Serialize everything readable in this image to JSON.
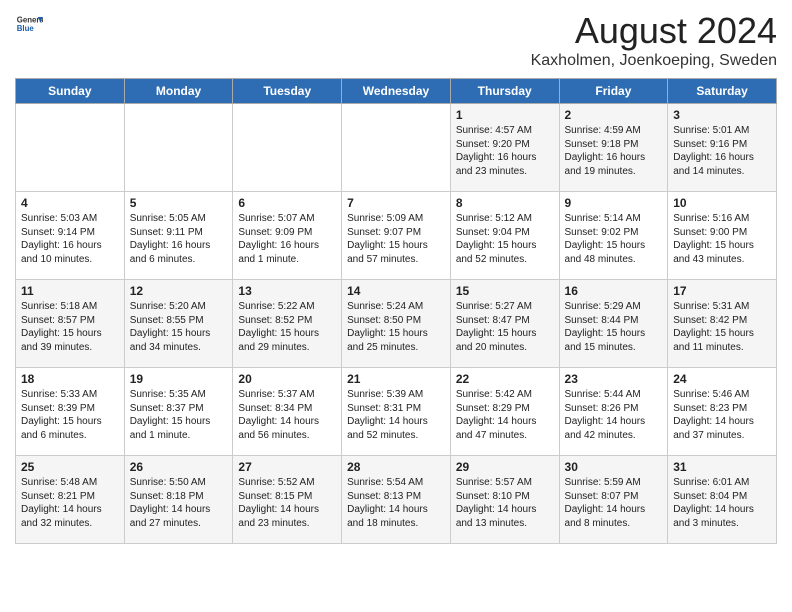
{
  "header": {
    "logo_general": "General",
    "logo_blue": "Blue",
    "title": "August 2024",
    "subtitle": "Kaxholmen, Joenkoeping, Sweden"
  },
  "days_of_week": [
    "Sunday",
    "Monday",
    "Tuesday",
    "Wednesday",
    "Thursday",
    "Friday",
    "Saturday"
  ],
  "weeks": [
    [
      {
        "day": "",
        "content": ""
      },
      {
        "day": "",
        "content": ""
      },
      {
        "day": "",
        "content": ""
      },
      {
        "day": "",
        "content": ""
      },
      {
        "day": "1",
        "content": "Sunrise: 4:57 AM\nSunset: 9:20 PM\nDaylight: 16 hours\nand 23 minutes."
      },
      {
        "day": "2",
        "content": "Sunrise: 4:59 AM\nSunset: 9:18 PM\nDaylight: 16 hours\nand 19 minutes."
      },
      {
        "day": "3",
        "content": "Sunrise: 5:01 AM\nSunset: 9:16 PM\nDaylight: 16 hours\nand 14 minutes."
      }
    ],
    [
      {
        "day": "4",
        "content": "Sunrise: 5:03 AM\nSunset: 9:14 PM\nDaylight: 16 hours\nand 10 minutes."
      },
      {
        "day": "5",
        "content": "Sunrise: 5:05 AM\nSunset: 9:11 PM\nDaylight: 16 hours\nand 6 minutes."
      },
      {
        "day": "6",
        "content": "Sunrise: 5:07 AM\nSunset: 9:09 PM\nDaylight: 16 hours\nand 1 minute."
      },
      {
        "day": "7",
        "content": "Sunrise: 5:09 AM\nSunset: 9:07 PM\nDaylight: 15 hours\nand 57 minutes."
      },
      {
        "day": "8",
        "content": "Sunrise: 5:12 AM\nSunset: 9:04 PM\nDaylight: 15 hours\nand 52 minutes."
      },
      {
        "day": "9",
        "content": "Sunrise: 5:14 AM\nSunset: 9:02 PM\nDaylight: 15 hours\nand 48 minutes."
      },
      {
        "day": "10",
        "content": "Sunrise: 5:16 AM\nSunset: 9:00 PM\nDaylight: 15 hours\nand 43 minutes."
      }
    ],
    [
      {
        "day": "11",
        "content": "Sunrise: 5:18 AM\nSunset: 8:57 PM\nDaylight: 15 hours\nand 39 minutes."
      },
      {
        "day": "12",
        "content": "Sunrise: 5:20 AM\nSunset: 8:55 PM\nDaylight: 15 hours\nand 34 minutes."
      },
      {
        "day": "13",
        "content": "Sunrise: 5:22 AM\nSunset: 8:52 PM\nDaylight: 15 hours\nand 29 minutes."
      },
      {
        "day": "14",
        "content": "Sunrise: 5:24 AM\nSunset: 8:50 PM\nDaylight: 15 hours\nand 25 minutes."
      },
      {
        "day": "15",
        "content": "Sunrise: 5:27 AM\nSunset: 8:47 PM\nDaylight: 15 hours\nand 20 minutes."
      },
      {
        "day": "16",
        "content": "Sunrise: 5:29 AM\nSunset: 8:44 PM\nDaylight: 15 hours\nand 15 minutes."
      },
      {
        "day": "17",
        "content": "Sunrise: 5:31 AM\nSunset: 8:42 PM\nDaylight: 15 hours\nand 11 minutes."
      }
    ],
    [
      {
        "day": "18",
        "content": "Sunrise: 5:33 AM\nSunset: 8:39 PM\nDaylight: 15 hours\nand 6 minutes."
      },
      {
        "day": "19",
        "content": "Sunrise: 5:35 AM\nSunset: 8:37 PM\nDaylight: 15 hours\nand 1 minute."
      },
      {
        "day": "20",
        "content": "Sunrise: 5:37 AM\nSunset: 8:34 PM\nDaylight: 14 hours\nand 56 minutes."
      },
      {
        "day": "21",
        "content": "Sunrise: 5:39 AM\nSunset: 8:31 PM\nDaylight: 14 hours\nand 52 minutes."
      },
      {
        "day": "22",
        "content": "Sunrise: 5:42 AM\nSunset: 8:29 PM\nDaylight: 14 hours\nand 47 minutes."
      },
      {
        "day": "23",
        "content": "Sunrise: 5:44 AM\nSunset: 8:26 PM\nDaylight: 14 hours\nand 42 minutes."
      },
      {
        "day": "24",
        "content": "Sunrise: 5:46 AM\nSunset: 8:23 PM\nDaylight: 14 hours\nand 37 minutes."
      }
    ],
    [
      {
        "day": "25",
        "content": "Sunrise: 5:48 AM\nSunset: 8:21 PM\nDaylight: 14 hours\nand 32 minutes."
      },
      {
        "day": "26",
        "content": "Sunrise: 5:50 AM\nSunset: 8:18 PM\nDaylight: 14 hours\nand 27 minutes."
      },
      {
        "day": "27",
        "content": "Sunrise: 5:52 AM\nSunset: 8:15 PM\nDaylight: 14 hours\nand 23 minutes."
      },
      {
        "day": "28",
        "content": "Sunrise: 5:54 AM\nSunset: 8:13 PM\nDaylight: 14 hours\nand 18 minutes."
      },
      {
        "day": "29",
        "content": "Sunrise: 5:57 AM\nSunset: 8:10 PM\nDaylight: 14 hours\nand 13 minutes."
      },
      {
        "day": "30",
        "content": "Sunrise: 5:59 AM\nSunset: 8:07 PM\nDaylight: 14 hours\nand 8 minutes."
      },
      {
        "day": "31",
        "content": "Sunrise: 6:01 AM\nSunset: 8:04 PM\nDaylight: 14 hours\nand 3 minutes."
      }
    ]
  ]
}
